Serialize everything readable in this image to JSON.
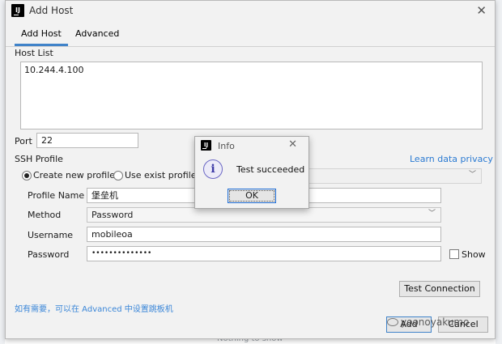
{
  "window": {
    "title": "Add Host",
    "icon_text": "IJ",
    "close_glyph": "✕"
  },
  "tabs": [
    {
      "label": "Add Host",
      "active": true
    },
    {
      "label": "Advanced",
      "active": false
    }
  ],
  "host_list": {
    "label": "Host List",
    "value": "10.244.4.100"
  },
  "port": {
    "label": "Port",
    "value": "22"
  },
  "ssh_profile": {
    "label": "SSH Profile",
    "learn_link": "Learn data privacy",
    "create_new_label": "Create new profile",
    "use_exist_label": "Use exist profile",
    "create_new_selected": true
  },
  "form": {
    "profile_name_label": "Profile Name",
    "profile_name_value": "堡垒机",
    "method_label": "Method",
    "method_value": "Password",
    "username_label": "Username",
    "username_value": "mobileoa",
    "password_label": "Password",
    "password_value": "••••••••••••••",
    "show_label": "Show"
  },
  "buttons": {
    "test_connection": "Test Connection",
    "add": "Add",
    "cancel": "Cancel"
  },
  "hint": "如有需要，可以在 Advanced 中设置跳板机",
  "info_dialog": {
    "title": "Info",
    "icon_text": "IJ",
    "close_glyph": "✕",
    "info_glyph": "i",
    "message": "Test succeeded",
    "ok_label": "OK"
  },
  "background": {
    "footer_text": "Nothing to show"
  },
  "watermark": "yoonoyakumo",
  "colors": {
    "accent": "#4083c9",
    "link": "#2a7ad2",
    "hint": "#3a86d8"
  }
}
